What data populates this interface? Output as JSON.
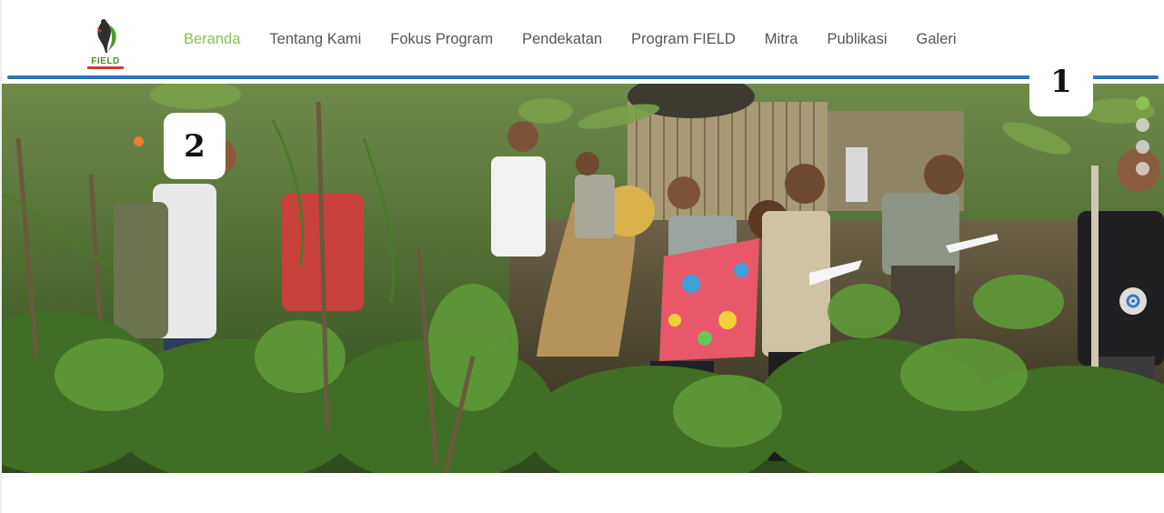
{
  "logo": {
    "text": "FIELD",
    "icon": "field-logo-icon"
  },
  "nav": {
    "items": [
      {
        "label": "Beranda",
        "active": true
      },
      {
        "label": "Tentang Kami",
        "active": false
      },
      {
        "label": "Fokus Program",
        "active": false
      },
      {
        "label": "Pendekatan",
        "active": false
      },
      {
        "label": "Program FIELD",
        "active": false
      },
      {
        "label": "Mitra",
        "active": false
      },
      {
        "label": "Publikasi",
        "active": false
      },
      {
        "label": "Galeri",
        "active": false
      }
    ]
  },
  "hero": {
    "slide_count": 4,
    "active_slide": 1
  },
  "annotations": {
    "badge_1": "1",
    "badge_2": "2"
  },
  "colors": {
    "accent": "#8cc152",
    "nav_text": "#555555",
    "header_line": "#2a74c0",
    "orange_dot": "#f07b2a"
  }
}
